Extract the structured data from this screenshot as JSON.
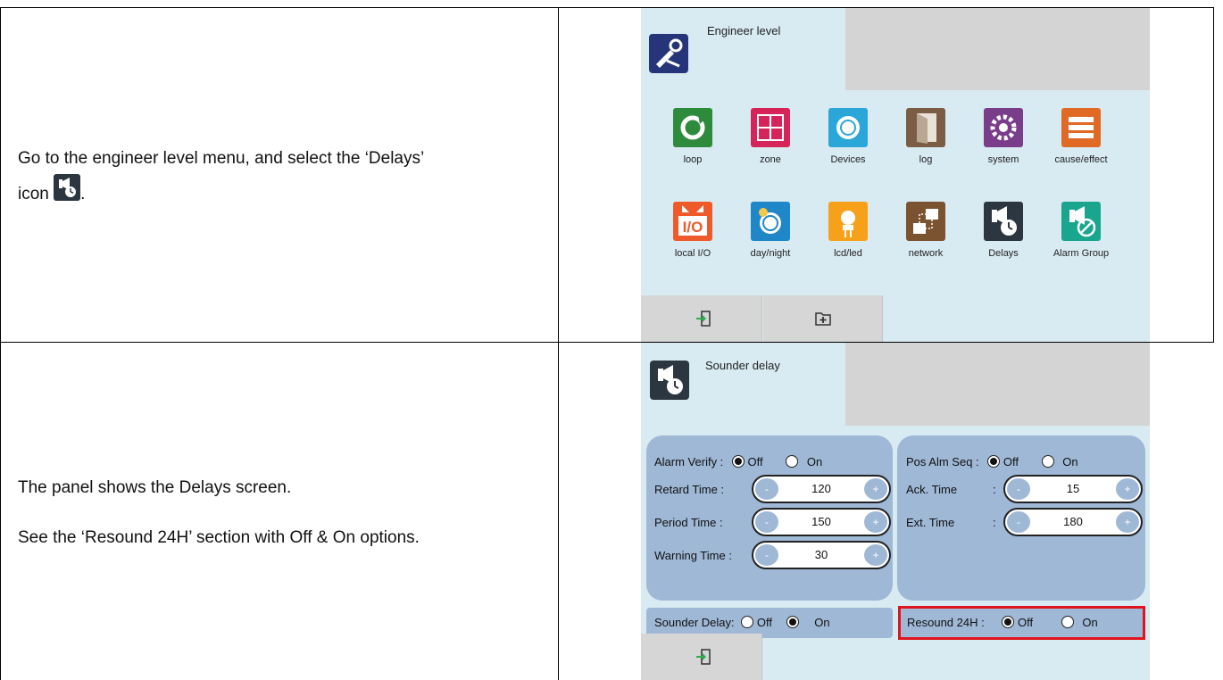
{
  "step1": {
    "text": "Go to the engineer level menu, and select the ‘Delays’",
    "text_icon_prefix": "icon",
    "text_icon_suffix": "."
  },
  "step2": {
    "text_line1": "The panel shows the Delays screen.",
    "text_line2": "See the ‘Resound 24H’ section with Off & On options."
  },
  "engineer_screen": {
    "title": "Engineer level",
    "apps": [
      {
        "label": "loop",
        "icon": "loop-icon",
        "color": "#2e8b3c"
      },
      {
        "label": "zone",
        "icon": "zone-icon",
        "color": "#d6245a"
      },
      {
        "label": "Devices",
        "icon": "devices-icon",
        "color": "#2aa6d8"
      },
      {
        "label": "log",
        "icon": "log-icon",
        "color": "#7b5c44"
      },
      {
        "label": "system",
        "icon": "system-icon",
        "color": "#7a3d8a"
      },
      {
        "label": "cause/effect",
        "icon": "cause-effect-icon",
        "color": "#e06a24"
      },
      {
        "label": "local I/O",
        "icon": "local-io-icon",
        "color": "#ee5a2a"
      },
      {
        "label": "day/night",
        "icon": "day-night-icon",
        "color": "#1f86c8"
      },
      {
        "label": "lcd/led",
        "icon": "lcd-led-icon",
        "color": "#f7a11a"
      },
      {
        "label": "network",
        "icon": "network-icon",
        "color": "#7b5330"
      },
      {
        "label": "Delays",
        "icon": "delays-icon",
        "color": "#2b3640"
      },
      {
        "label": "Alarm Group",
        "icon": "alarm-group-icon",
        "color": "#1aa68e"
      }
    ],
    "io_text": "I/O"
  },
  "delays_screen": {
    "title": "Sounder delay",
    "alarm_verify": {
      "label": "Alarm Verify  :",
      "off": "Off",
      "on": "On",
      "selected": "off"
    },
    "retard_time": {
      "label": "Retard Time   :",
      "value": "120"
    },
    "period_time": {
      "label": "Period Time   :",
      "value": "150"
    },
    "warning_time": {
      "label": "Warning Time :",
      "value": "30"
    },
    "pos_alm_seq": {
      "label": "Pos Alm Seq  :",
      "off": "Off",
      "on": "On",
      "selected": "off"
    },
    "ack_time": {
      "label": "Ack. Time",
      "colon": ":",
      "value": "15"
    },
    "ext_time": {
      "label": "Ext. Time",
      "colon": ":",
      "value": "180"
    },
    "sounder_delay": {
      "label": "Sounder Delay:",
      "off": "Off",
      "on": "On",
      "selected": "on"
    },
    "resound_24h": {
      "label": "Resound 24H :",
      "off": "Off",
      "on": "On",
      "selected": "off"
    },
    "minus": "-",
    "plus": "+"
  },
  "colors": {
    "panel_bg": "#d8eaf2",
    "group_bg": "#9fb8d6",
    "highlight": "#e0141e",
    "exit_arrow": "#2bb04a"
  }
}
